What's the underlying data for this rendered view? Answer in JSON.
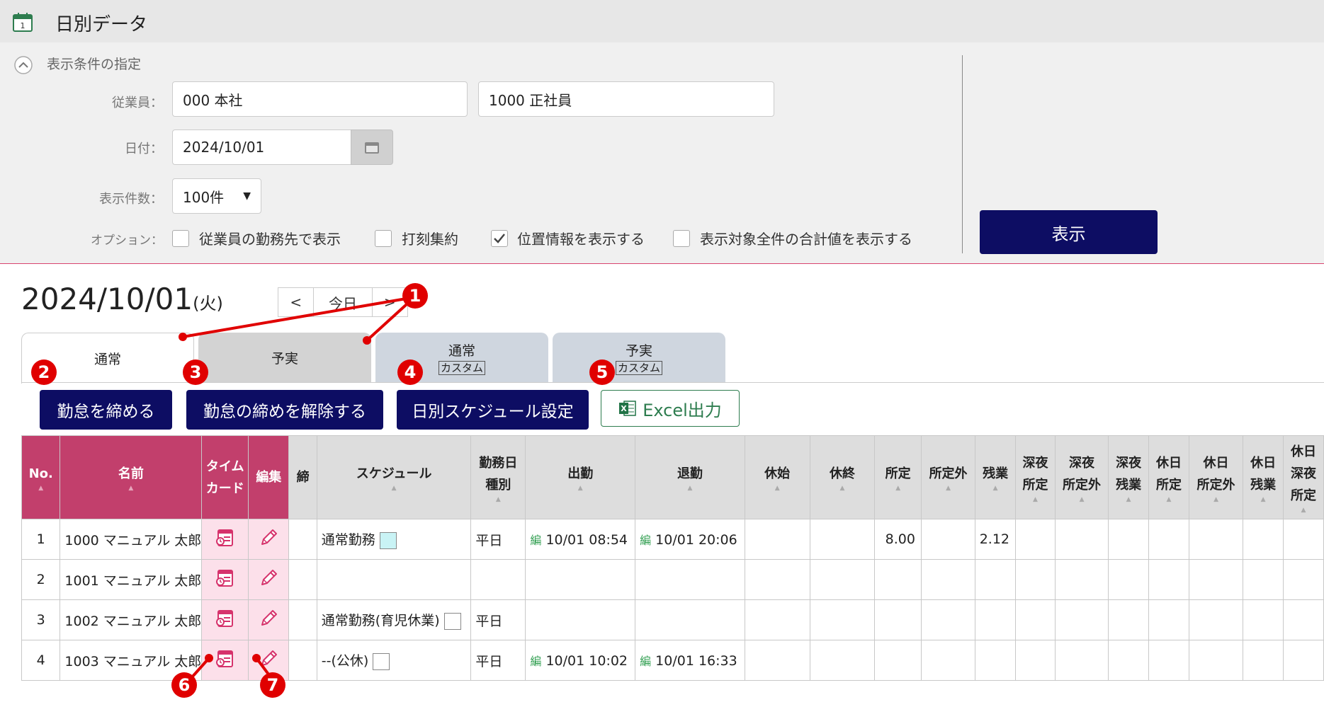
{
  "header": {
    "title": "日別データ",
    "icon": "calendar-icon"
  },
  "filter": {
    "heading": "表示条件の指定",
    "employee_label": "従業員：",
    "employee_office": "000 本社",
    "employee_type": "1000 正社員",
    "date_label": "日付：",
    "date_value": "2024/10/01",
    "count_label": "表示件数：",
    "count_value": "100件",
    "option_label": "オプション：",
    "options": [
      {
        "label": "従業員の勤務先で表示",
        "checked": false
      },
      {
        "label": "打刻集約",
        "checked": false
      },
      {
        "label": "位置情報を表示する",
        "checked": true
      },
      {
        "label": "表示対象全件の合計値を表示する",
        "checked": false
      }
    ],
    "show_button": "表示"
  },
  "date_nav": {
    "date": "2024/10/01",
    "weekday": "(火)",
    "prev": "<",
    "today": "今日",
    "next": ">"
  },
  "tabs": [
    {
      "label": "通常",
      "sub": "",
      "active": true
    },
    {
      "label": "予実",
      "sub": "",
      "active": false
    },
    {
      "label": "通常",
      "sub": "カスタム",
      "active": false
    },
    {
      "label": "予実",
      "sub": "カスタム",
      "active": false
    }
  ],
  "actions": {
    "close": "勤怠を締める",
    "unclose": "勤怠の締めを解除する",
    "schedule": "日別スケジュール設定",
    "excel": "Excel出力"
  },
  "table": {
    "columns": [
      {
        "key": "no",
        "lines": [
          "No."
        ],
        "pink": true
      },
      {
        "key": "name",
        "lines": [
          "名前"
        ],
        "pink": true
      },
      {
        "key": "timecard",
        "lines": [
          "タイム",
          "カード"
        ],
        "pink": true
      },
      {
        "key": "edit",
        "lines": [
          "編集"
        ],
        "pink": true
      },
      {
        "key": "close",
        "lines": [
          "締"
        ]
      },
      {
        "key": "schedule",
        "lines": [
          "スケジュール"
        ]
      },
      {
        "key": "daytype",
        "lines": [
          "勤務日",
          "種別"
        ]
      },
      {
        "key": "in",
        "lines": [
          "出勤"
        ]
      },
      {
        "key": "out",
        "lines": [
          "退勤"
        ]
      },
      {
        "key": "brk_start",
        "lines": [
          "休始"
        ]
      },
      {
        "key": "brk_end",
        "lines": [
          "休終"
        ]
      },
      {
        "key": "sched",
        "lines": [
          "所定"
        ]
      },
      {
        "key": "non_sched",
        "lines": [
          "所定外"
        ]
      },
      {
        "key": "overtime",
        "lines": [
          "残業"
        ]
      },
      {
        "key": "late_sched",
        "lines": [
          "深夜",
          "所定"
        ]
      },
      {
        "key": "late_non",
        "lines": [
          "深夜",
          "所定外"
        ]
      },
      {
        "key": "late_ot",
        "lines": [
          "深夜",
          "残業"
        ]
      },
      {
        "key": "hol_sched",
        "lines": [
          "休日",
          "所定"
        ]
      },
      {
        "key": "hol_non",
        "lines": [
          "休日",
          "所定外"
        ]
      },
      {
        "key": "hol_ot",
        "lines": [
          "休日",
          "残業"
        ]
      },
      {
        "key": "hol_late",
        "lines": [
          "休日",
          "深夜",
          "所定"
        ]
      }
    ],
    "rows": [
      {
        "no": "1",
        "name": "1000 マニュアル 太郎",
        "schedule": "通常勤務",
        "swatch": "#c9f3f5",
        "daytype": "平日",
        "in_tag": "編",
        "in": "10/01 08:54",
        "out_tag": "編",
        "out": "10/01 20:06",
        "sched": "8.00",
        "overtime": "2.12"
      },
      {
        "no": "2",
        "name": "1001 マニュアル 太郎",
        "schedule": "",
        "swatch": "",
        "daytype": "",
        "in_tag": "",
        "in": "",
        "out_tag": "",
        "out": "",
        "sched": "",
        "overtime": ""
      },
      {
        "no": "3",
        "name": "1002 マニュアル 太郎",
        "schedule": "通常勤務(育児休業)",
        "swatch": "#ffffff",
        "daytype": "平日",
        "in_tag": "",
        "in": "",
        "out_tag": "",
        "out": "",
        "sched": "",
        "overtime": ""
      },
      {
        "no": "4",
        "name": "1003 マニュアル 太郎",
        "schedule": "--(公休)",
        "swatch": "#ffffff",
        "daytype": "平日",
        "in_tag": "編",
        "in": "10/01 10:02",
        "out_tag": "編",
        "out": "10/01 16:33",
        "sched": "",
        "overtime": ""
      }
    ]
  },
  "annotations": [
    "1",
    "2",
    "3",
    "4",
    "5",
    "6",
    "7"
  ],
  "colors": {
    "navy": "#0d0d63",
    "pink_header": "#c23f6c",
    "pink_cell": "#fce0ea",
    "badge": "#e00000"
  }
}
